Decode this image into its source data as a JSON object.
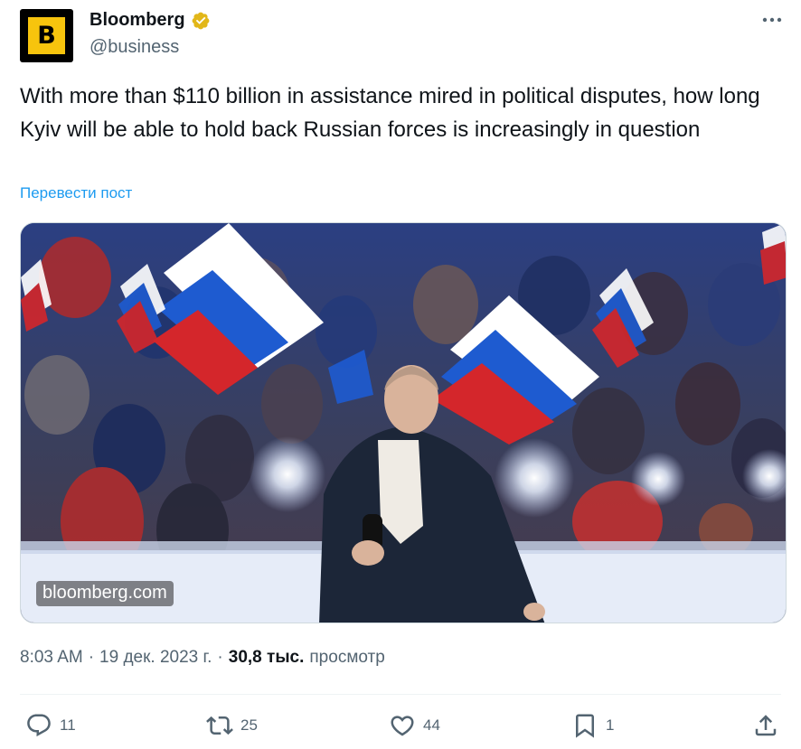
{
  "author": {
    "avatar_letter": "B",
    "display_name": "Bloomberg",
    "handle": "@business",
    "verified": true,
    "badge_color": "#e2b719"
  },
  "tweet": {
    "text": "With more than $110 billion in assistance mired in political disputes, how long Kyiv will be able to hold back Russian forces is increasingly in question",
    "translate_label": "Перевести пост",
    "media_watermark": "bloomberg.com"
  },
  "meta": {
    "time": "8:03 AM",
    "date": "19 дек. 2023 г.",
    "views_count": "30,8 тыс.",
    "views_label": "просмотр"
  },
  "actions": {
    "replies": "11",
    "reposts": "25",
    "likes": "44",
    "bookmarks": "1"
  },
  "colors": {
    "text": "#0f1419",
    "secondary": "#536471",
    "link": "#1d9bf0",
    "avatar_bg": "#000000",
    "avatar_fg": "#f7c40d"
  },
  "icons": [
    "more-icon",
    "verified-badge-icon",
    "reply-icon",
    "repost-icon",
    "like-icon",
    "bookmark-icon",
    "share-icon"
  ]
}
